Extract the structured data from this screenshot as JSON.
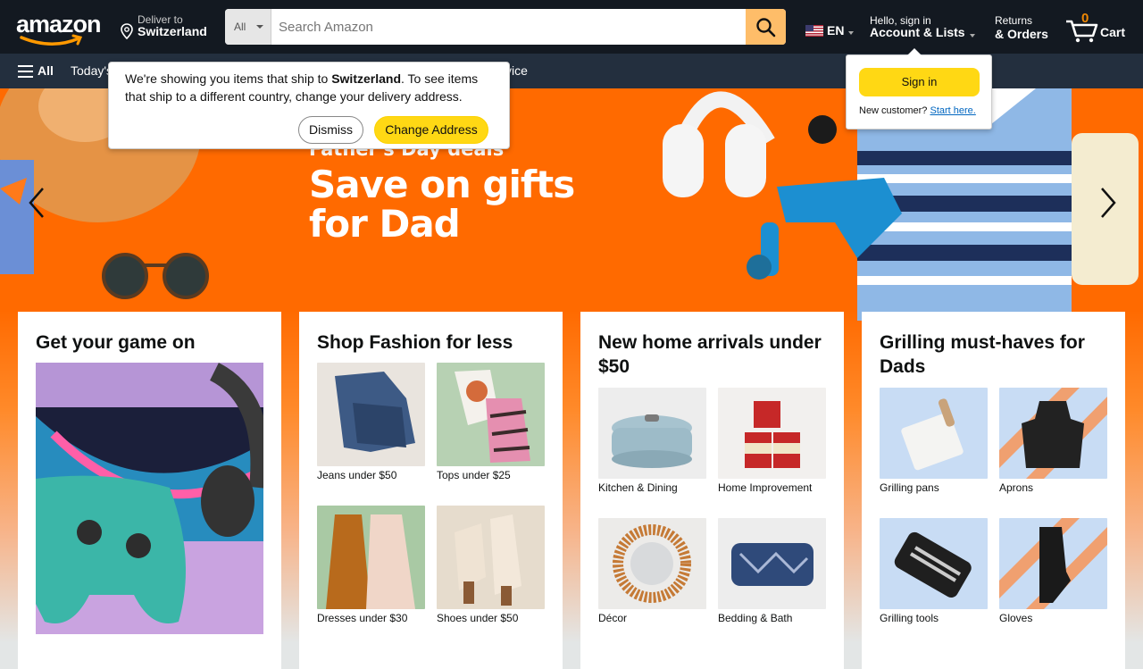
{
  "header": {
    "logo_text": "amazon",
    "deliver_line1": "Deliver to",
    "deliver_line2": "Switzerland",
    "search_category": "All",
    "search_placeholder": "Search Amazon",
    "language": "EN",
    "account_line1": "Hello, sign in",
    "account_line2": "Account & Lists",
    "returns_line1": "Returns",
    "returns_line2": "& Orders",
    "cart_count": "0",
    "cart_label": "Cart"
  },
  "subnav": {
    "all_label": "All",
    "links": [
      "Today's",
      "vice"
    ]
  },
  "hero": {
    "kicker": "Father's Day deals",
    "title": "Save on gifts for Dad"
  },
  "address_popover": {
    "message_pre": "We're showing you items that ship to ",
    "country": "Switzerland",
    "message_post": ". To see items that ship to a different country, change your delivery address.",
    "dismiss_label": "Dismiss",
    "change_label": "Change Address"
  },
  "signin_flyout": {
    "button_label": "Sign in",
    "new_customer": "New customer?",
    "start_here": "Start here."
  },
  "cards": [
    {
      "title": "Get your game on"
    },
    {
      "title": "Shop Fashion for less",
      "tiles": [
        "Jeans under $50",
        "Tops under $25",
        "Dresses under $30",
        "Shoes under $50"
      ]
    },
    {
      "title": "New home arrivals under $50",
      "tiles": [
        "Kitchen & Dining",
        "Home Improvement",
        "Décor",
        "Bedding & Bath"
      ]
    },
    {
      "title": "Grilling must-haves for Dads",
      "tiles": [
        "Grilling pans",
        "Aprons",
        "Grilling tools",
        "Gloves"
      ]
    }
  ],
  "colors": {
    "nav_dark": "#131921",
    "nav_secondary": "#232f3e",
    "search_button": "#febd69",
    "accent_yellow": "#ffd814",
    "hero_orange": "#ff6a00",
    "cart_count": "#f08804"
  }
}
